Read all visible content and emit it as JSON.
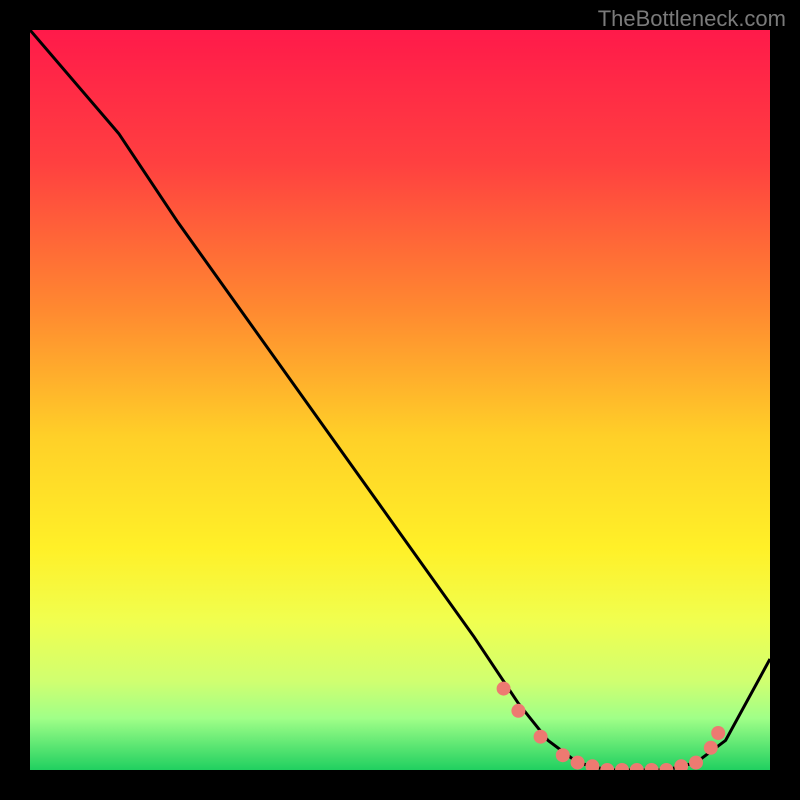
{
  "watermark": "TheBottleneck.com",
  "chart_data": {
    "type": "line",
    "title": "",
    "xlabel": "",
    "ylabel": "",
    "xlim": [
      0,
      100
    ],
    "ylim": [
      0,
      100
    ],
    "grid": false,
    "background_gradient": {
      "stops": [
        {
          "offset": 0,
          "color": "#ff1a4a"
        },
        {
          "offset": 18,
          "color": "#ff4040"
        },
        {
          "offset": 38,
          "color": "#ff8a30"
        },
        {
          "offset": 55,
          "color": "#ffd028"
        },
        {
          "offset": 70,
          "color": "#fff028"
        },
        {
          "offset": 80,
          "color": "#f0ff50"
        },
        {
          "offset": 88,
          "color": "#d0ff70"
        },
        {
          "offset": 93,
          "color": "#a0ff88"
        },
        {
          "offset": 100,
          "color": "#20d060"
        }
      ]
    },
    "series": [
      {
        "name": "curve",
        "color": "#000000",
        "x": [
          0,
          6,
          12,
          20,
          30,
          40,
          50,
          60,
          66,
          70,
          74,
          78,
          82,
          86,
          90,
          94,
          100
        ],
        "y": [
          100,
          93,
          86,
          74,
          60,
          46,
          32,
          18,
          9,
          4,
          1,
          0,
          0,
          0,
          1,
          4,
          15
        ]
      }
    ],
    "markers": {
      "name": "flat-region-dots",
      "color": "#ed7a71",
      "x": [
        64,
        66,
        69,
        72,
        74,
        76,
        78,
        80,
        82,
        84,
        86,
        88,
        90,
        92,
        93
      ],
      "y": [
        11,
        8,
        4.5,
        2,
        1,
        0.5,
        0,
        0,
        0,
        0,
        0,
        0.5,
        1,
        3,
        5
      ]
    }
  }
}
